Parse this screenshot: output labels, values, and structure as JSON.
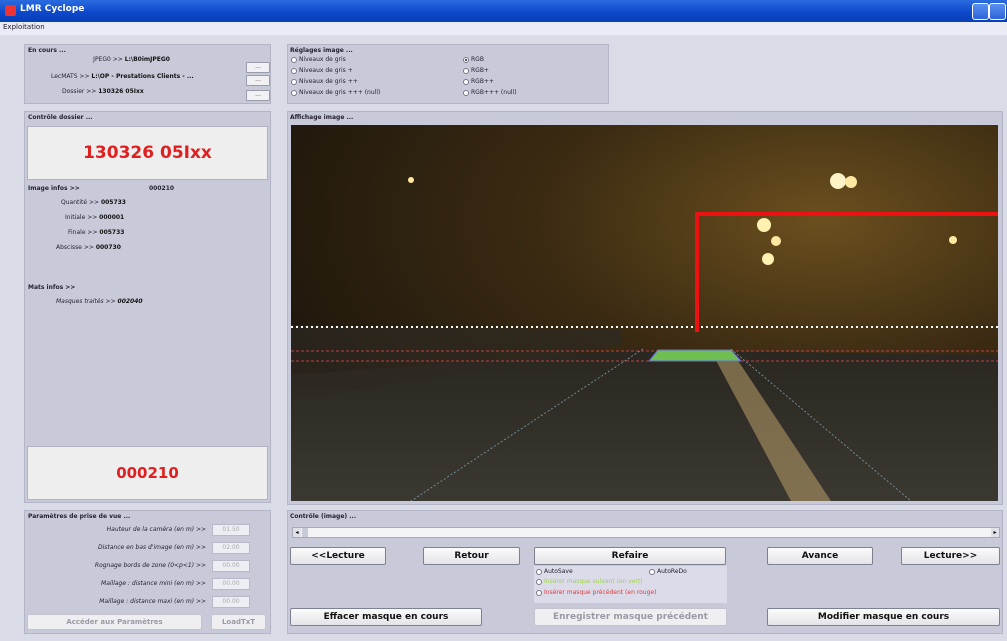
{
  "window": {
    "title": "LMR Cyclope",
    "menu": [
      "Exploitation"
    ]
  },
  "en_cours": {
    "title": "En cours ...",
    "rows": [
      {
        "label": "JPEG0 >> ",
        "value": "L:\\B0imJPEG0",
        "button": "..."
      },
      {
        "label": "LecMATS >> ",
        "value": "L:\\OP - Prestations Clients - ...",
        "button": "..."
      },
      {
        "label": "Dossier >> ",
        "value": "130326 05Ixx",
        "button": "..."
      }
    ]
  },
  "reglages": {
    "title": "Réglages image ...",
    "options_left": [
      "Niveaux de gris",
      "Niveaux de gris +",
      "Niveaux de gris ++",
      "Niveaux de gris +++ (null)"
    ],
    "options_right": [
      "RGB",
      "RGB+",
      "RGB++",
      "RGB+++ (null)"
    ],
    "selected_right": 0
  },
  "controle_dossier": {
    "title": "Contrôle dossier ...",
    "dossier_name": "130326 05Ixx",
    "image_infos_label": "Image infos >>",
    "image_infos_value": "000210",
    "rows": [
      {
        "label": "Quantité >> ",
        "value": "005733"
      },
      {
        "label": "Initiale >> ",
        "value": "000001"
      },
      {
        "label": "Finale >> ",
        "value": "005733"
      },
      {
        "label": "Abscisse >> ",
        "value": "000730"
      }
    ],
    "mats_label": "Mats infos >>",
    "masques_label": "Masques traités >> ",
    "masques_value": "002040",
    "current_image": "000210"
  },
  "affichage": {
    "title": "Affichage image ..."
  },
  "parametres": {
    "title": "Paramètres de prise de vue ...",
    "rows": [
      {
        "label": "Hauteur de la caméra (en m) >>",
        "value": "01.50"
      },
      {
        "label": "Distance en bas d'image (en m) >>",
        "value": "02.00"
      },
      {
        "label": "Rognage bords de zone (0<p<1) >>",
        "value": "00.00"
      },
      {
        "label": "Maillage : distance mini (en m) >>",
        "value": "00.00"
      },
      {
        "label": "Maillage : distance maxi (en m) >>",
        "value": "00.00"
      }
    ],
    "acceder_button": "Accéder aux Paramètres",
    "loadtxt_button": "LoadTxT"
  },
  "controle_image": {
    "title": "Contrôle (image) ...",
    "buttons": {
      "lecture_back": "<<Lecture",
      "retour": "Retour",
      "refaire": "Refaire",
      "avance": "Avance",
      "lecture_fwd": "Lecture>>"
    },
    "autosave": "AutoSave",
    "autoredo": "AutoReDo",
    "opt_green": "Insérer masque suivant (en vert)",
    "opt_red": "Insérer masque précédent (en rouge)",
    "effacer": "Effacer masque en cours",
    "enregistrer": "Enregistrer masque précédent",
    "modifier": "Modifier masque en cours"
  },
  "colors": {
    "accent_red": "#e02020",
    "titlebar_blue": "#0b47c9"
  }
}
